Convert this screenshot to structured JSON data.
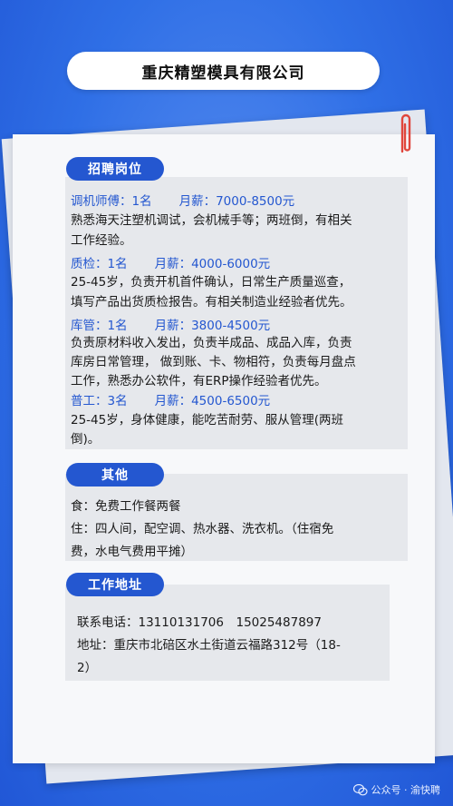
{
  "header": {
    "title": "重庆精塑模具有限公司"
  },
  "recruit": {
    "label": "招聘岗位",
    "jobs": [
      {
        "title": "调机师傅：1名",
        "salary": "月薪：7000-8500元",
        "desc": [
          "熟悉海天注塑机调试，会机械手等；两班倒，有相关",
          "工作经验。"
        ]
      },
      {
        "title": "质检：1名",
        "salary": "月薪：4000-6000元",
        "desc": [
          "25-45岁，负责开机首件确认，日常生产质量巡查，",
          "填写产品出货质检报告。有相关制造业经验者优先。"
        ]
      },
      {
        "title": "库管：1名",
        "salary": "月薪：3800-4500元",
        "desc": [
          "负责原材料收入发出，负责半成品、成品入库，负责",
          "库房日常管理， 做到账、卡、物相符，负责每月盘点",
          "工作，熟悉办公软件，有ERP操作经验者优先。"
        ]
      },
      {
        "title": "普工：3名",
        "salary": "月薪：4500-6500元",
        "desc": [
          "25-45岁，身体健康，能吃苦耐劳、服从管理(两班",
          "倒)。"
        ]
      }
    ]
  },
  "other": {
    "label": "其他",
    "lines": [
      "食：免费工作餐两餐",
      "住：四人间，配空调、热水器、洗衣机。（住宿免",
      "费，水电气费用平摊）"
    ]
  },
  "address": {
    "label": "工作地址",
    "lines": [
      "联系电话：13110131706　15025487897",
      "地址：重庆市北碚区水土街道云福路312号（18-",
      "2）"
    ]
  },
  "footer": {
    "text": "公众号 · 渝快聘"
  }
}
